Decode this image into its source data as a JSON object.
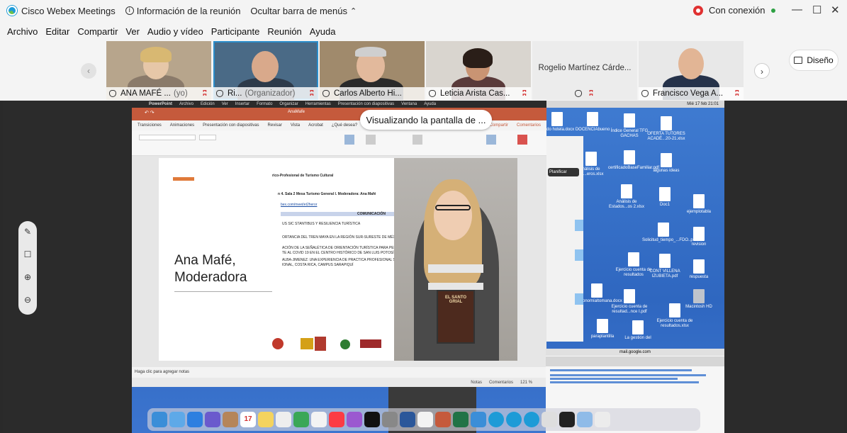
{
  "titlebar": {
    "app_title": "Cisco Webex Meetings",
    "meeting_info": "Información de la reunión",
    "hide_menu": "Ocultar barra de menús",
    "connection": "Con conexión",
    "minimize": "—",
    "maximize": "☐",
    "close": "✕"
  },
  "menu": [
    "Archivo",
    "Editar",
    "Compartir",
    "Ver",
    "Audio y vídeo",
    "Participante",
    "Reunión",
    "Ayuda"
  ],
  "participants": [
    {
      "name": "ANA MAFÉ ...",
      "role": "(yo)"
    },
    {
      "name": "Ri...",
      "role": "(Organizador)"
    },
    {
      "name": "Carlos Alberto Hi...",
      "role": ""
    },
    {
      "name": "Leticia Arista Cas...",
      "role": ""
    },
    {
      "name": "Rogelio Martínez Cárde...",
      "role": ""
    },
    {
      "name": "Francisco Vega A...",
      "role": ""
    }
  ],
  "layout_button": "Diseño",
  "share_banner": "Visualizando la pantalla de ...",
  "ppt": {
    "app": "PowerPoint",
    "menu": [
      "Archivo",
      "Edición",
      "Ver",
      "Insertar",
      "Formato",
      "Organizar",
      "Herramientas",
      "Presentación con diapositivas",
      "Ventana",
      "Ayuda"
    ],
    "tabs": [
      "Transiciones",
      "Animaciones",
      "Presentación con diapositivas",
      "Revisar",
      "Vista",
      "Acrobat",
      "¿Qué desea?"
    ],
    "doc_title": "AnaMafe",
    "share": "Compartir",
    "comments": "Comentarios",
    "notes_placeholder": "Haga clic para agregar notas",
    "status_notes": "Notas",
    "status_comments": "Comentarios",
    "zoom": "121 %"
  },
  "slide": {
    "moderator": "Ana Mafé,",
    "moderator2": "Moderadora",
    "header": "rico-Profesional de Turismo Cultural",
    "session": "n 4. Sala 2 Mesa Turismo General I. Moderadora: Ana Mafé",
    "link": "bex.com/meet/et2heror",
    "column": "COMUNICACIÓN",
    "rows": [
      "US SIC STANTIBUS Y RESILIENCIA TURÍSTICA",
      "ORTANCIA DEL TREN MAYA EN LA REGIÓN SUR-SURESTE DE MÉXICO",
      "ACIÓN DE LA SEÑALÉTICA DE ORIENTACIÓN TURÍSTICA PARA PERSONAS CON",
      "TE AL COVID 19 EN EL CENTRO HISTÓRICO DE SAN LUIS POTOSÍ",
      "ALBA-JIMENEZ: UNA EXPERIENCIA DE PRACTICA PROFESIONAL SUPERVISADA",
      "IONAL, COSTA RICA, CAMPUS SARAPIQUÍ"
    ],
    "book_title": "EL SANTO GRIAL"
  },
  "desktop": {
    "clock": "Mié 17 feb 21:01",
    "icons": [
      "ficado hotela.docx",
      "DOCENCIAbueno",
      "Índice General TFG GACHAS",
      "OFERTA TUTORES ACADÉ...20-21.xlsx",
      "nálisis de os...eros.xlsx",
      "certificadoBaseFamiliar.pdf",
      "algunas ideas",
      "Análisis de Estados...os 2.xlsx",
      "Doc1",
      "ejemplotabla",
      "Solicitud_tiempo_...FDO..pdf",
      "revision",
      "Ejercicio cuenta de resultados",
      "CONT VILLENA IZUBIETA.pdf",
      "respuesta",
      "astronomíaltomana.docx",
      "Ejercicio cuenta de resultad...nce I.pdf",
      "Macintosh HD",
      "Ejercicio cuenta de resultados.xlsx",
      "paraplantilla",
      "La gestión del"
    ],
    "mail_url": "mail.google.com",
    "side_label": "Planificar"
  },
  "dock_date": "17",
  "colors": {
    "accent": "#2c8ecb",
    "muted": "#d32f2f",
    "ppt": "#c55a3c"
  }
}
